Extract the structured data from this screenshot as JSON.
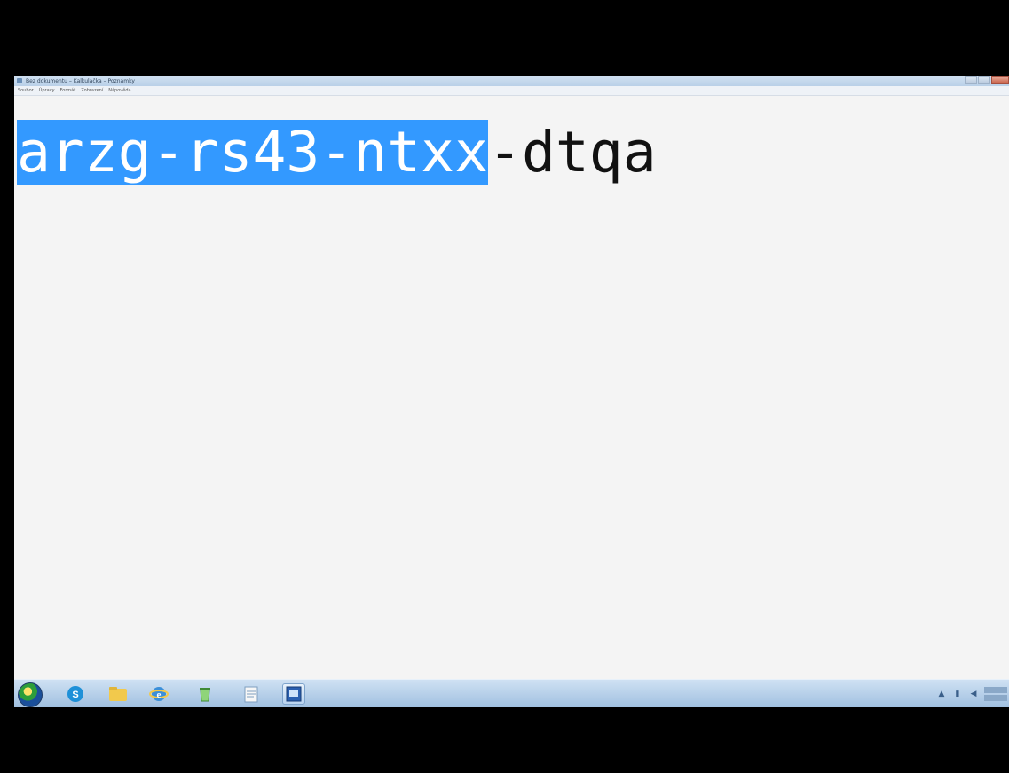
{
  "window": {
    "title": "Bez dokumentu – Kalkulačka – Poznámky",
    "menu": [
      "Soubor",
      "Úpravy",
      "Formát",
      "Zobrazení",
      "Nápověda"
    ]
  },
  "editor": {
    "selected_text": "arzg-rs43-ntxx",
    "unselected_text": "-dtqa",
    "selection_color": "#3399ff"
  },
  "taskbar": {
    "apps": [
      {
        "icon": "windows-start-icon"
      },
      {
        "icon": "skype-icon"
      },
      {
        "icon": "folder-icon"
      },
      {
        "icon": "internet-explorer-icon"
      },
      {
        "icon": "recycle-icon"
      },
      {
        "icon": "notepad-icon"
      },
      {
        "icon": "remote-desktop-icon"
      }
    ],
    "tray": {
      "icons": [
        "arrow-up-icon",
        "network-icon",
        "volume-icon"
      ]
    }
  }
}
